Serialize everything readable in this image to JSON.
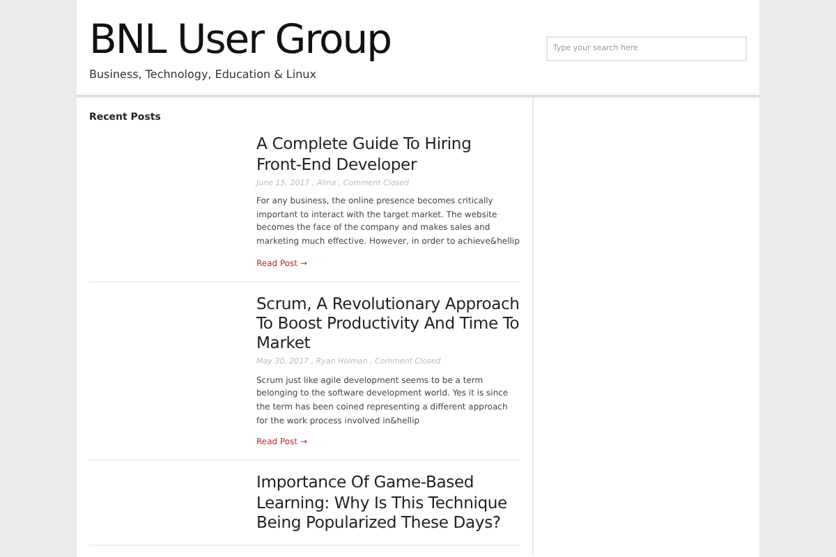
{
  "site": {
    "title": "BNL User Group",
    "tagline": "Business, Technology, Education & Linux"
  },
  "search": {
    "placeholder": "Type your search here"
  },
  "section_title": "Recent Posts",
  "posts": [
    {
      "title": "A Complete Guide To Hiring Front-End Developer",
      "meta": "June 15, 2017 , Alina , Comment Closed",
      "excerpt": "For any business, the online presence becomes critically important to interact with the target market. The website becomes the face of the company and makes sales and marketing much effective. However, in order to achieve&hellip",
      "link": "Read Post →"
    },
    {
      "title": "Scrum, A Revolutionary Approach To Boost Productivity And Time To Market",
      "meta": "May 30, 2017 , Ryan Holman , Comment Closed",
      "excerpt": "Scrum just like agile development seems to be a term belonging to the software development world. Yes it is since the term has been coined representing a different approach for the work process involved in&hellip",
      "link": "Read Post →"
    },
    {
      "title": "Importance Of Game-Based Learning: Why Is This Technique Being Popularized These Days?"
    }
  ]
}
